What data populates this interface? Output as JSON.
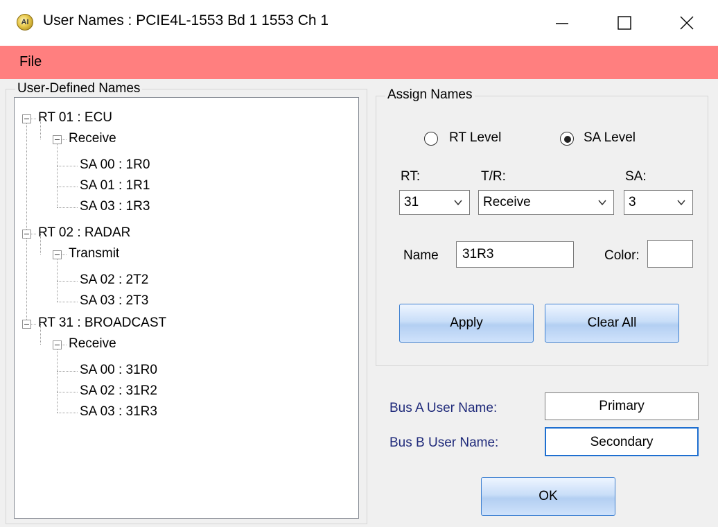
{
  "window": {
    "title": "User Names : PCIE4L-1553 Bd 1 1553 Ch 1",
    "app_icon_text": "AI"
  },
  "menu": {
    "file_label": "File"
  },
  "tree": {
    "group_label": "User-Defined Names",
    "rt1": {
      "label": "RT 01 : ECU",
      "dir": "Receive",
      "sa": [
        "SA 00 : 1R0",
        "SA 01 : 1R1",
        "SA 03 : 1R3"
      ]
    },
    "rt2": {
      "label": "RT 02 : RADAR",
      "dir": "Transmit",
      "sa": [
        "SA 02 : 2T2",
        "SA 03 : 2T3"
      ]
    },
    "rt3": {
      "label": "RT 31 : BROADCAST",
      "dir": "Receive",
      "sa": [
        "SA 00 : 31R0",
        "SA 02 : 31R2",
        "SA 03 : 31R3"
      ]
    }
  },
  "assign": {
    "group_label": "Assign Names",
    "radio_rt_label": "RT Level",
    "radio_sa_label": "SA Level",
    "selected_level": "SA Level",
    "rt_label": "RT:",
    "rt_value": "31",
    "tr_label": "T/R:",
    "tr_value": "Receive",
    "sa_label": "SA:",
    "sa_value": "3",
    "name_label": "Name",
    "name_value": "31R3",
    "color_label": "Color:",
    "apply_label": "Apply",
    "clear_label": "Clear All"
  },
  "bus": {
    "a_label": "Bus A User Name:",
    "a_value": "Primary",
    "b_label": "Bus B User Name:",
    "b_value": "Secondary"
  },
  "ok_label": "OK",
  "colors": {
    "menubar": "#ff7f7f",
    "bus_label": "#1f2a7a",
    "button_border": "#3c7fd0"
  }
}
